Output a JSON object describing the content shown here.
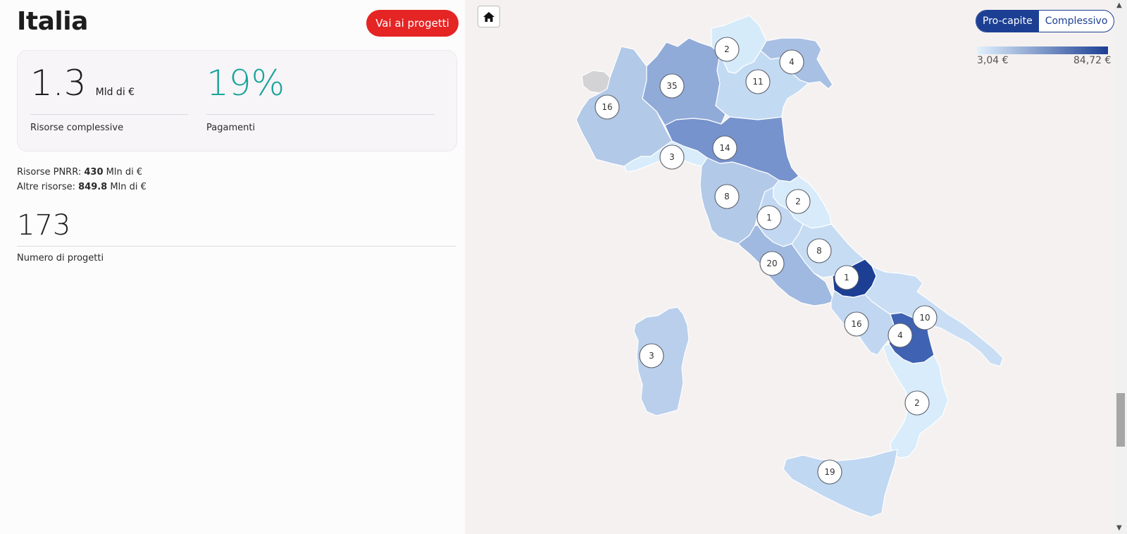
{
  "panel": {
    "title": "Italia",
    "cta_label": "Vai ai progetti",
    "resources_value": "1.3",
    "resources_unit": "Mld di  €",
    "resources_label": "Risorse complessive",
    "payments_value": "19%",
    "payments_label": "Pagamenti",
    "pnrr_label": "Risorse PNRR: ",
    "pnrr_value": "430",
    "pnrr_unit": " Mln di €",
    "other_label": "Altre risorse: ",
    "other_value": "849.8",
    "other_unit": " Mln di €",
    "projects_count": "173",
    "projects_label": "Numero di progetti"
  },
  "map": {
    "toggle": {
      "active": "Pro-capite",
      "inactive": "Complessivo"
    },
    "legend": {
      "min": "3,04 €",
      "max": "84,72 €",
      "color_min": "#e1f1fd",
      "color_max": "#1c3f94"
    },
    "home_icon": "home-icon",
    "regions": [
      {
        "name": "valle-d-aosta",
        "projects": "",
        "color": "#d3d3d5"
      },
      {
        "name": "piemonte",
        "projects": "16",
        "color": "#b2c9e8"
      },
      {
        "name": "lombardia",
        "projects": "35",
        "color": "#91abd9"
      },
      {
        "name": "trentino-alto-adige",
        "projects": "2",
        "color": "#d6ebfa"
      },
      {
        "name": "veneto",
        "projects": "11",
        "color": "#c3daf3"
      },
      {
        "name": "friuli-venezia-giulia",
        "projects": "4",
        "color": "#a8c0e4"
      },
      {
        "name": "liguria",
        "projects": "3",
        "color": "#d8ecfb"
      },
      {
        "name": "emilia-romagna",
        "projects": "14",
        "color": "#7793cd"
      },
      {
        "name": "toscana",
        "projects": "8",
        "color": "#b2c9e8"
      },
      {
        "name": "umbria",
        "projects": "1",
        "color": "#c2d8f2"
      },
      {
        "name": "marche",
        "projects": "2",
        "color": "#d7ebfa"
      },
      {
        "name": "lazio",
        "projects": "20",
        "color": "#a0b9e0"
      },
      {
        "name": "abruzzo",
        "projects": "8",
        "color": "#c6dcf3"
      },
      {
        "name": "molise",
        "projects": "1",
        "color": "#1c3f94"
      },
      {
        "name": "campania",
        "projects": "16",
        "color": "#c1d7f1"
      },
      {
        "name": "puglia",
        "projects": "10",
        "color": "#c9def5"
      },
      {
        "name": "basilicata",
        "projects": "4",
        "color": "#3f62b2"
      },
      {
        "name": "calabria",
        "projects": "2",
        "color": "#d8ecfb"
      },
      {
        "name": "sicilia",
        "projects": "19",
        "color": "#c1d8f2"
      },
      {
        "name": "sardegna",
        "projects": "3",
        "color": "#b9cfec"
      }
    ]
  }
}
